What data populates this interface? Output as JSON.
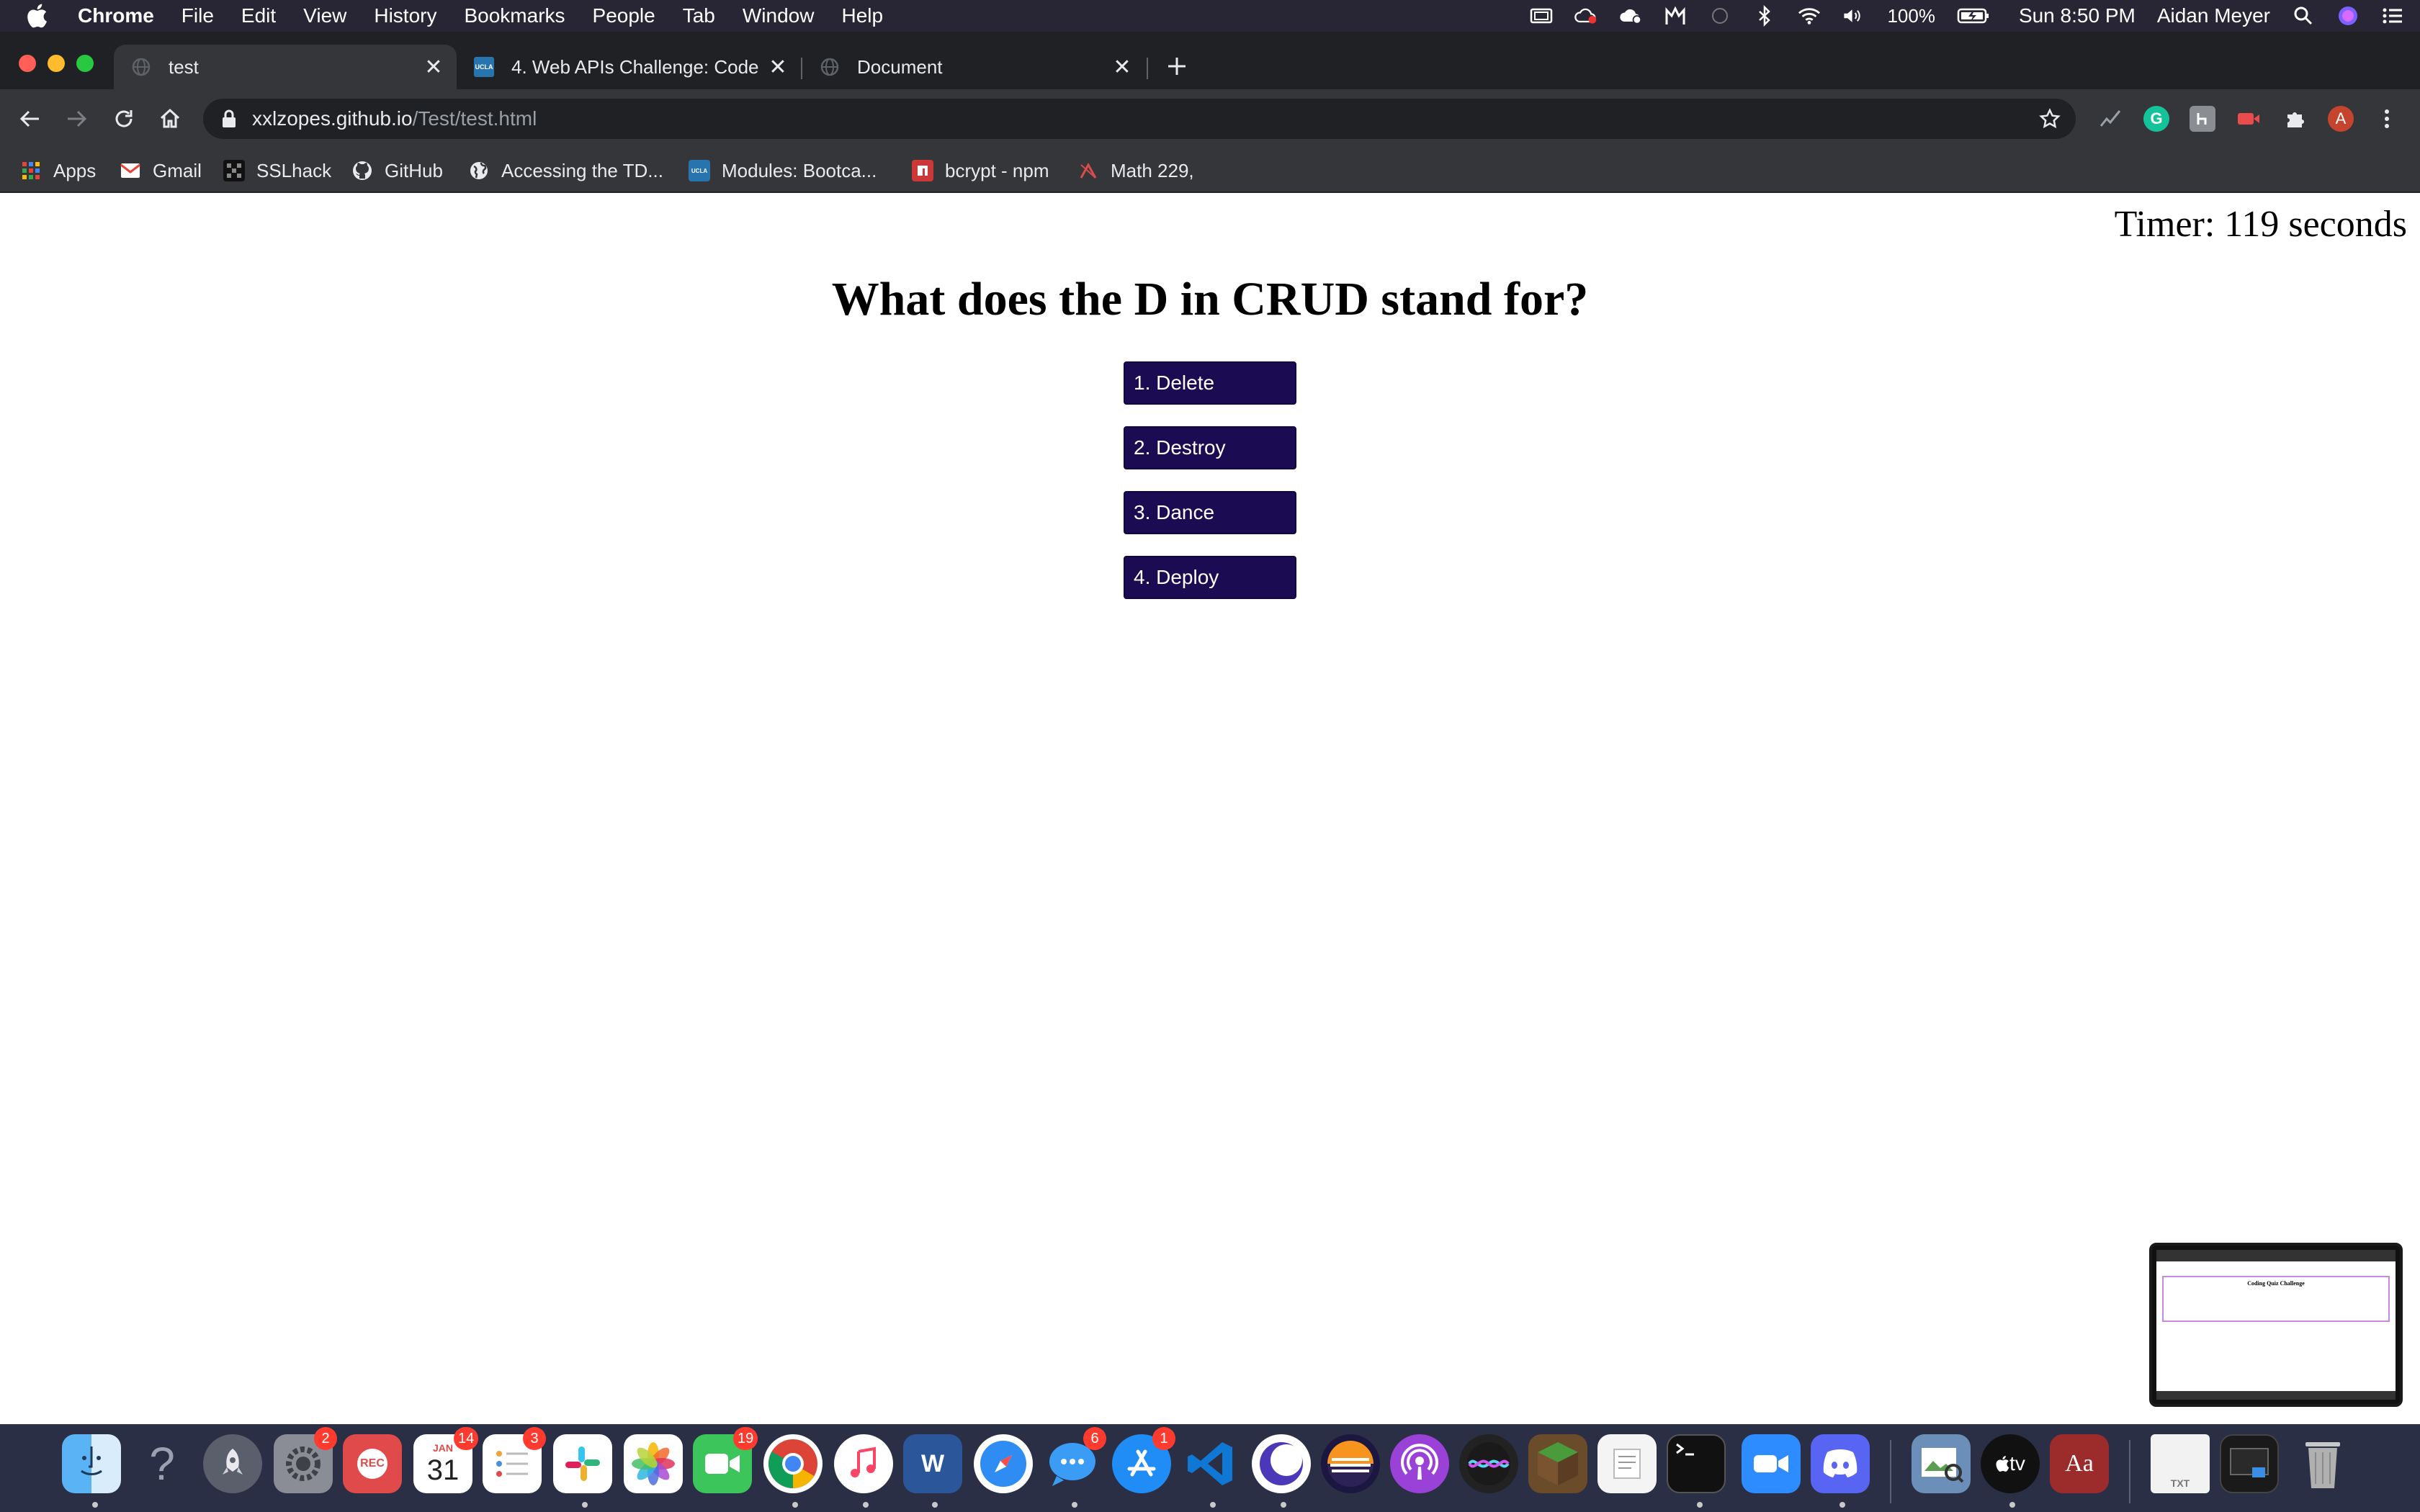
{
  "menubar": {
    "app_name": "Chrome",
    "menus": [
      "File",
      "Edit",
      "View",
      "History",
      "Bookmarks",
      "People",
      "Tab",
      "Window",
      "Help"
    ],
    "battery": "100%",
    "clock": "Sun 8:50 PM",
    "user": "Aidan Meyer"
  },
  "tabs": [
    {
      "title": "test",
      "favicon": "globe-icon",
      "active": true
    },
    {
      "title": "4. Web APIs Challenge: Code Quiz",
      "favicon": "ucla-icon",
      "active": false
    },
    {
      "title": "Document",
      "favicon": "globe-icon",
      "active": false
    }
  ],
  "toolbar": {
    "url_host": "xxlzopes.github.io",
    "url_path": "/Test/test.html",
    "profile_initial": "A",
    "extension_g": "G"
  },
  "bookmarks": [
    {
      "label": "Apps",
      "icon": "apps-grid-icon"
    },
    {
      "label": "Gmail",
      "icon": "gmail-icon"
    },
    {
      "label": "SSLhack",
      "icon": "sslhack-icon"
    },
    {
      "label": "GitHub",
      "icon": "github-icon"
    },
    {
      "label": "Accessing the TD...",
      "icon": "globe-icon"
    },
    {
      "label": "Modules: Bootca...",
      "icon": "ucla-icon"
    },
    {
      "label": "bcrypt - npm",
      "icon": "npm-icon"
    },
    {
      "label": "Math 229,",
      "icon": "math-icon"
    }
  ],
  "page": {
    "timer": "Timer: 119 seconds",
    "question": "What does the D in CRUD stand for?",
    "answers": [
      "1. Delete",
      "2. Destroy",
      "3. Dance",
      "4. Deploy"
    ],
    "answer_button_color": "#1b0b52"
  },
  "pip_preview": {
    "title": "Coding Quiz Challenge"
  },
  "dock": {
    "badges": {
      "system_preferences": "2",
      "calendar": "14",
      "reminders": "3",
      "facetime": "19",
      "messages": "6",
      "app_store": "1"
    },
    "calendar_month": "JAN",
    "calendar_day": "31",
    "rec_label": "REC",
    "tv_label": "tv",
    "dictionary_label": "Aa",
    "word_label": "W",
    "txt_label": "TXT"
  }
}
